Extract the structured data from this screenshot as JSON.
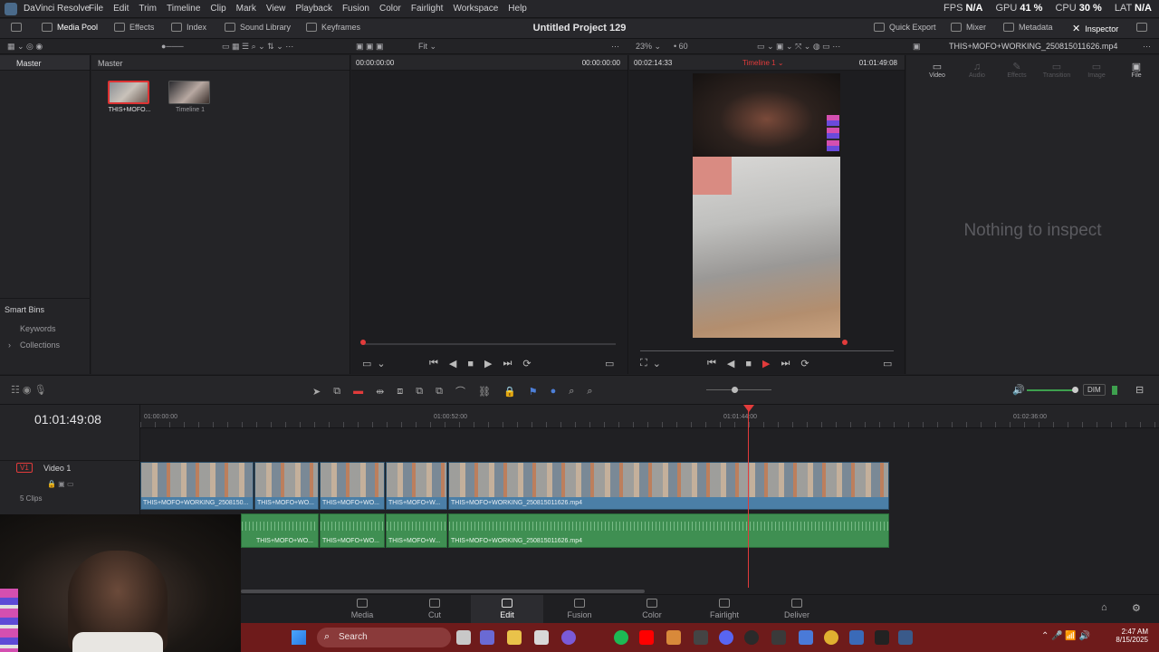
{
  "menubar": {
    "app_name": "DaVinci Resolve",
    "menus": [
      "File",
      "Edit",
      "Trim",
      "Timeline",
      "Clip",
      "Mark",
      "View",
      "Playback",
      "Fusion",
      "Color",
      "Fairlight",
      "Workspace",
      "Help"
    ],
    "stats": [
      {
        "label": "FPS",
        "value": "N/A"
      },
      {
        "label": "GPU",
        "value": "41 %"
      },
      {
        "label": "CPU",
        "value": "30 %"
      },
      {
        "label": "LAT",
        "value": "N/A"
      }
    ]
  },
  "toolbar": {
    "media_pool": "Media Pool",
    "effects": "Effects",
    "index": "Index",
    "sound_library": "Sound Library",
    "keyframes": "Keyframes",
    "project_title": "Untitled Project 129",
    "quick_export": "Quick Export",
    "mixer": "Mixer",
    "metadata": "Metadata",
    "inspector": "Inspector"
  },
  "subbar": {
    "fit": "Fit",
    "zoom": "23%",
    "fps": "60",
    "clip_name": "THIS+MOFO+WORKING_250815011626.mp4"
  },
  "bins": {
    "master": "Master",
    "smart_bins": "Smart Bins",
    "keywords": "Keywords",
    "collections": "Collections"
  },
  "media_pool": {
    "header": "Master",
    "items": [
      {
        "label": "THIS+MOFO..."
      },
      {
        "label": "Timeline 1"
      }
    ]
  },
  "source_viewer": {
    "tc_left": "00:00:00:00",
    "tc_right": "00:00:00:00"
  },
  "timeline_viewer": {
    "duration": "00:02:14:33",
    "timeline_name": "Timeline 1",
    "timecode": "01:01:49:08"
  },
  "inspector": {
    "tabs": [
      "Video",
      "Audio",
      "Effects",
      "Transition",
      "Image",
      "File"
    ],
    "empty_message": "Nothing to inspect"
  },
  "timeline": {
    "current_tc": "01:01:49:08",
    "ruler_labels": [
      "01:00:00:00",
      "01:00:52:00",
      "01:01:44:00",
      "01:02:36:00"
    ],
    "track_v1": {
      "tag": "V1",
      "name": "Video 1",
      "clips_count": "5 Clips"
    },
    "dim": "DIM",
    "video_clips": [
      "THIS+MOFO+WORKING_2508150...",
      "THIS+MOFO+WO...",
      "THIS+MOFO+WO...",
      "THIS+MOFO+W...",
      "THIS+MOFO+WORKING_250815011626.mp4"
    ],
    "audio_clips": [
      "THIS+MOFO+WO...",
      "THIS+MOFO+WO...",
      "THIS+MOFO+W...",
      "THIS+MOFO+WORKING_250815011626.mp4"
    ]
  },
  "pages": [
    "Media",
    "Cut",
    "Edit",
    "Fusion",
    "Color",
    "Fairlight",
    "Deliver"
  ],
  "active_page": "Edit",
  "taskbar": {
    "search": "Search",
    "time": "2:47 AM",
    "date": "8/15/2025"
  },
  "colors": {
    "accent_red": "#e23b3b",
    "video_clip": "#4b7fa7",
    "audio_clip": "#3f8f52",
    "taskbar": "#6e1b1b"
  }
}
